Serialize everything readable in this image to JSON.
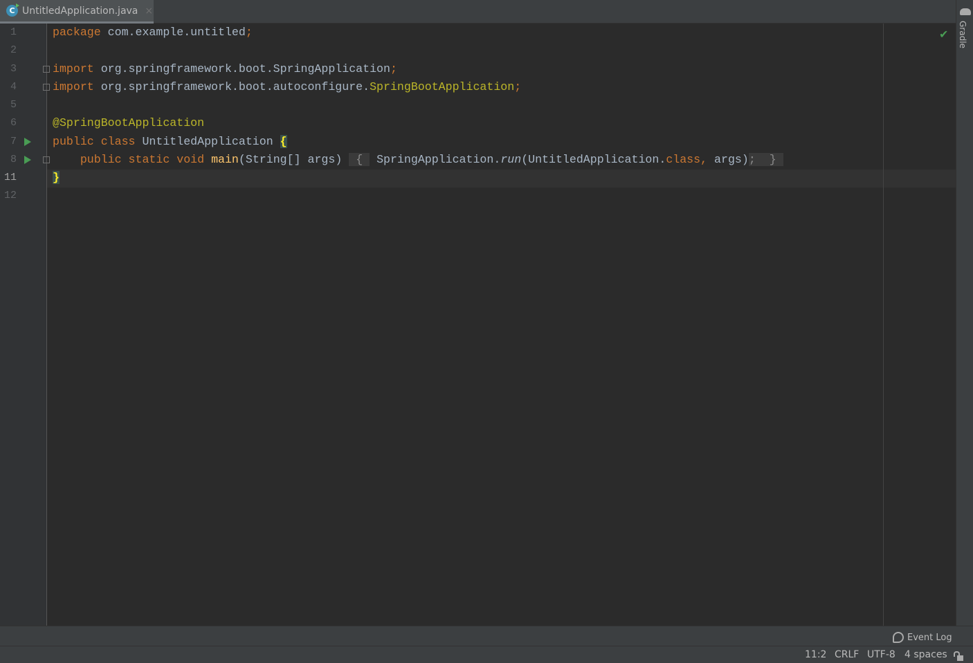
{
  "tab": {
    "filename": "UntitledApplication.java",
    "icon": "java-class-icon",
    "close": "×"
  },
  "gutter": {
    "line_numbers": [
      "1",
      "2",
      "3",
      "4",
      "5",
      "6",
      "7",
      "8",
      "11",
      "12"
    ],
    "current_line": "11"
  },
  "code_lines": [
    [
      {
        "t": "package",
        "c": "kw"
      },
      {
        "t": " com.example.untitled"
      },
      {
        "t": ";",
        "c": "sem"
      }
    ],
    [],
    [
      {
        "t": "import",
        "c": "kw"
      },
      {
        "t": " org.springframework.boot.SpringApplication"
      },
      {
        "t": ";",
        "c": "sem"
      }
    ],
    [
      {
        "t": "import",
        "c": "kw"
      },
      {
        "t": " org.springframework.boot.autoconfigure."
      },
      {
        "t": "SpringBootApplication",
        "c": "ann"
      },
      {
        "t": ";",
        "c": "sem"
      }
    ],
    [],
    [
      {
        "t": "@SpringBootApplication",
        "c": "ann"
      }
    ],
    [
      {
        "t": "public class",
        "c": "kw"
      },
      {
        "t": " UntitledApplication "
      },
      {
        "t": "{",
        "c": "brace"
      }
    ],
    [
      {
        "t": "    "
      },
      {
        "t": "public static void",
        "c": "kw"
      },
      {
        "t": " "
      },
      {
        "t": "main",
        "c": "fn"
      },
      {
        "t": "(String[] args) "
      },
      {
        "t": " { ",
        "c": "fldb"
      },
      {
        "t": " SpringApplication."
      },
      {
        "t": "run",
        "c": "it"
      },
      {
        "t": "(UntitledApplication."
      },
      {
        "t": "class",
        "c": "kw"
      },
      {
        "t": ", ",
        "c": "sem"
      },
      {
        "t": "args)"
      },
      {
        "t": "; ",
        "c": "fldb sem"
      },
      {
        "t": " } ",
        "c": "fldb"
      }
    ],
    [
      {
        "t": "}",
        "c": "brace"
      }
    ],
    []
  ],
  "right_panel": {
    "gradle_label": "Gradle",
    "inspection_status": "✔"
  },
  "status_bar": {
    "event_log": "Event Log",
    "position": "11:2",
    "line_ending": "CRLF",
    "encoding": "UTF-8",
    "indent": "4 spaces"
  }
}
